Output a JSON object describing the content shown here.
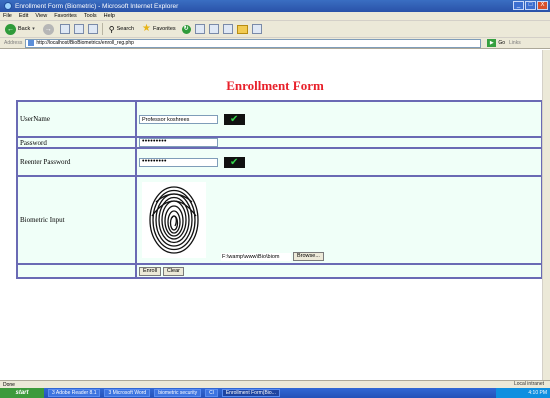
{
  "window": {
    "title": "Enrollment Form (Biometric) - Microsoft Internet Explorer",
    "controls": [
      "_",
      "□",
      "X"
    ]
  },
  "menu": [
    "File",
    "Edit",
    "View",
    "Favorites",
    "Tools",
    "Help"
  ],
  "toolbar": {
    "back_label": "Back",
    "search_label": "Search",
    "favorites_label": "Favorites"
  },
  "address": {
    "label": "Address",
    "url": "http://localhost/BioBiometrics/enroll_reg.php",
    "go_label": "Go",
    "links_label": "Links"
  },
  "form": {
    "title": "Enrollment Form",
    "rows": {
      "username_label": "UserName",
      "username_value": "Professor koshrees",
      "password_label": "Password",
      "password_value": "•••••••••",
      "reenter_label": "Reenter Password",
      "reenter_value": "•••••••••",
      "biometric_label": "Biometric Input",
      "file_path": "F:\\wamp\\www\\Bio\\biom",
      "browse_label": "Browse..."
    },
    "enroll_label": "Enroll",
    "clear_label": "Clear",
    "check_mark": "✔"
  },
  "status": {
    "left": "Done",
    "right": "Local intranet"
  },
  "taskbar": {
    "start_label": "start",
    "items": [
      "3 Adobe Reader 8.1",
      "3 Microsoft Word",
      "biometric security",
      "Cl",
      "Enrollment Form(Bio..."
    ],
    "clock": "4:10 PM"
  },
  "colors": {
    "form_title": "#e8202a",
    "table_border": "#6a6ab4",
    "cell_background": "#f0fff8",
    "check_green": "#34d64b"
  }
}
